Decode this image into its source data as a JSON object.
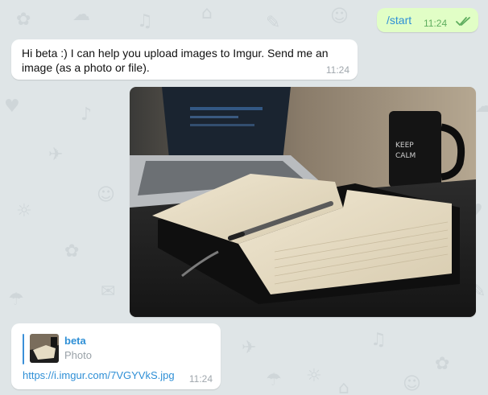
{
  "messages": {
    "outgoing_start": {
      "text": "/start",
      "time": "11:24"
    },
    "incoming_greeting": {
      "text": "Hi beta :) I can help you upload images to Imgur. Send me an image (as a photo or file).",
      "time": "11:24"
    },
    "incoming_link": {
      "preview_name": "beta",
      "preview_type": "Photo",
      "url": "https://i.imgur.com/7VGYVkS.jpg",
      "time": "11:24"
    }
  },
  "icons": {
    "read_receipt": "double-check-icon",
    "photo": "notebook-laptop-photo"
  },
  "colors": {
    "outgoing_bubble": "#e1fec6",
    "incoming_bubble": "#ffffff",
    "link": "#2e8fd6",
    "background": "#dfe5e7"
  }
}
